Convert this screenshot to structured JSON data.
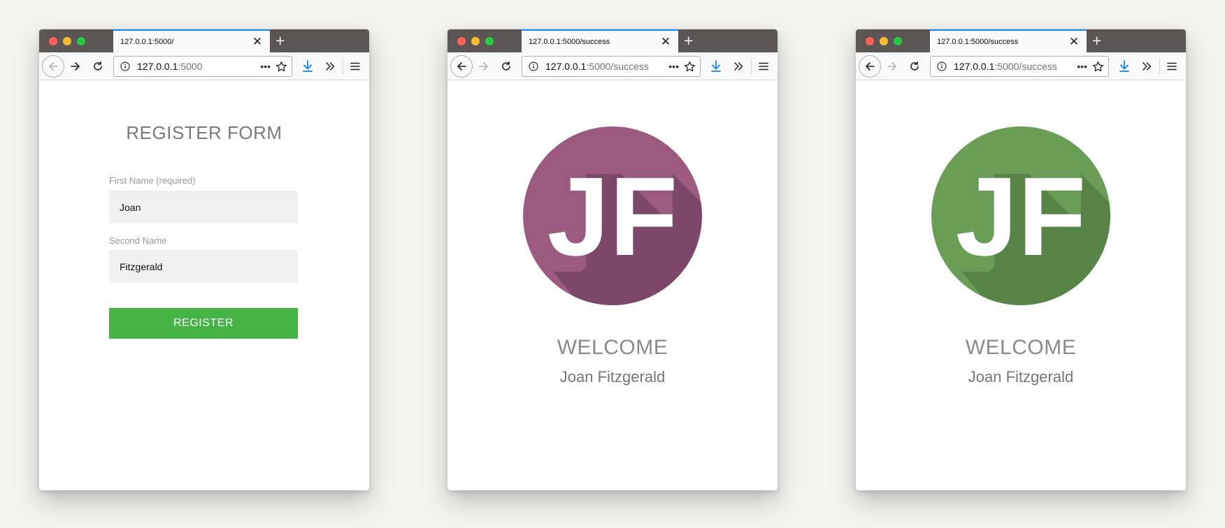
{
  "windows": [
    {
      "tab_title": "127.0.0.1:5000/",
      "url_host": "127.0.0.1",
      "url_path": ":5000",
      "forward_enabled": true,
      "page": {
        "title": "REGISTER FORM",
        "first_name_label": "First Name (required)",
        "first_name_value": "Joan",
        "second_name_label": "Second Name",
        "second_name_value": "Fitzgerald",
        "register_label": "REGISTER"
      }
    },
    {
      "tab_title": "127.0.0.1:5000/success",
      "url_host": "127.0.0.1",
      "url_path": ":5000/success",
      "forward_enabled": false,
      "page": {
        "avatar_initials": "JF",
        "avatar_color": "#9b5a7e",
        "avatar_shadow_color": "#7c4768",
        "welcome": "WELCOME",
        "name": "Joan Fitzgerald"
      }
    },
    {
      "tab_title": "127.0.0.1:5000/success",
      "url_host": "127.0.0.1",
      "url_path": ":5000/success",
      "forward_enabled": false,
      "page": {
        "avatar_initials": "JF",
        "avatar_color": "#6a9d56",
        "avatar_shadow_color": "#588447",
        "welcome": "WELCOME",
        "name": "Joan Fitzgerald"
      }
    }
  ],
  "icons": {
    "back": "arrow-left-icon",
    "forward": "arrow-right-icon",
    "reload": "reload-icon",
    "info": "info-icon",
    "more": "more-dots-icon",
    "bookmark": "star-icon",
    "download": "download-icon",
    "overflow": "chevrons-right-icon",
    "menu": "hamburger-icon",
    "close_tab": "close-icon",
    "new_tab": "plus-icon"
  },
  "colors": {
    "register_button": "#46b347",
    "title_bar": "#5b5556",
    "download_icon": "#0a84ff"
  }
}
